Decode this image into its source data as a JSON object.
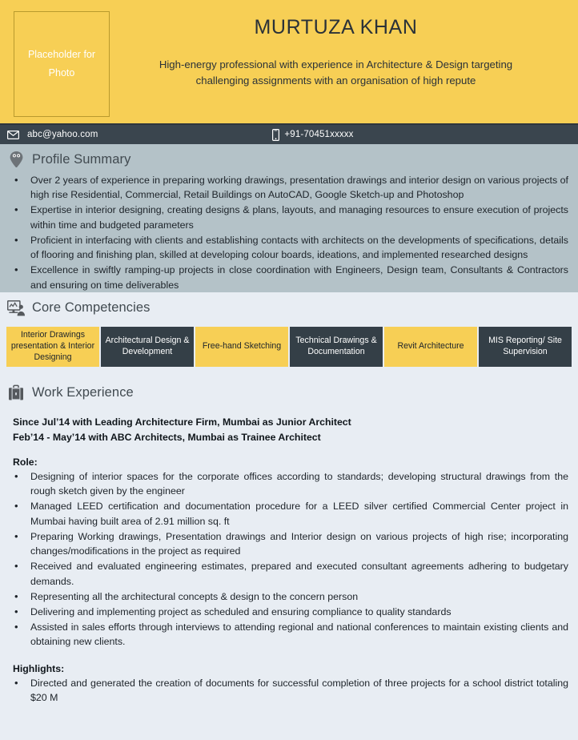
{
  "header": {
    "photo_placeholder_line1": "Placeholder for",
    "photo_placeholder_line2": "Photo",
    "name": "MURTUZA KHAN",
    "tagline": "High-energy professional with experience in Architecture & Design targeting challenging assignments with an organisation of high repute",
    "bg_color": "#F7CF55"
  },
  "contact": {
    "email": "abc@yahoo.com",
    "phone": "+91-70451xxxxx",
    "bg_color": "#3A454E"
  },
  "profile_summary": {
    "title": "Profile Summary",
    "bullets": [
      "Over 2 years of experience in preparing working drawings, presentation drawings and interior design on various projects of high rise Residential, Commercial, Retail Buildings on AutoCAD, Google Sketch-up and Photoshop",
      "Expertise in interior designing, creating designs & plans, layouts, and managing resources to ensure execution of projects within time and budgeted parameters",
      "Proficient in interfacing with clients and establishing contacts with architects on the developments of specifications, details of flooring and finishing plan, skilled at developing colour boards, ideations, and implemented researched designs",
      "Excellence in swiftly ramping-up projects in close coordination with Engineers, Design team, Consultants & Contractors and ensuring on time deliverables"
    ]
  },
  "core_competencies": {
    "title": "Core Competencies",
    "items": [
      {
        "label": "Interior Drawings presentation & Interior Designing",
        "style": "yellow"
      },
      {
        "label": "Architectural Design & Development",
        "style": "dark"
      },
      {
        "label": "Free-hand Sketching",
        "style": "yellow"
      },
      {
        "label": "Technical Drawings & Documentation",
        "style": "dark"
      },
      {
        "label": "Revit Architecture",
        "style": "yellow"
      },
      {
        "label": "MIS Reporting/ Site Supervision",
        "style": "dark"
      }
    ]
  },
  "work_experience": {
    "title": "Work Experience",
    "job_line_1": "Since Jul’14 with Leading Architecture Firm, Mumbai as Junior Architect",
    "job_line_2": "Feb’14 - May’14 with ABC Architects, Mumbai as Trainee Architect",
    "role_label": "Role:",
    "role_bullets": [
      "Designing of interior spaces for the corporate offices according to standards; developing structural drawings from the rough sketch given by the engineer",
      "Managed LEED certification and documentation procedure for a LEED silver certified Commercial Center project in Mumbai having built area of 2.91 million sq. ft",
      "Preparing Working drawings, Presentation drawings and Interior design on various projects of high rise; incorporating changes/modifications in the project as required",
      "Received and evaluated engineering estimates, prepared and executed consultant agreements adhering to budgetary demands.",
      "Representing all the architectural concepts & design to the concern person",
      "Delivering and implementing project as scheduled and ensuring compliance to quality standards",
      "Assisted in sales efforts through interviews to attending regional and national conferences to maintain existing clients and obtaining new clients."
    ],
    "highlights_label": "Highlights:",
    "highlight_bullets": [
      "Directed and generated the creation of documents for successful completion of three projects for a school district totaling $20 M"
    ]
  },
  "colors": {
    "accent_yellow": "#F7CF55",
    "dark_slate": "#3A454E",
    "section_bg": "#B4C2C8",
    "light_section_bg": "#E8EDF3"
  }
}
